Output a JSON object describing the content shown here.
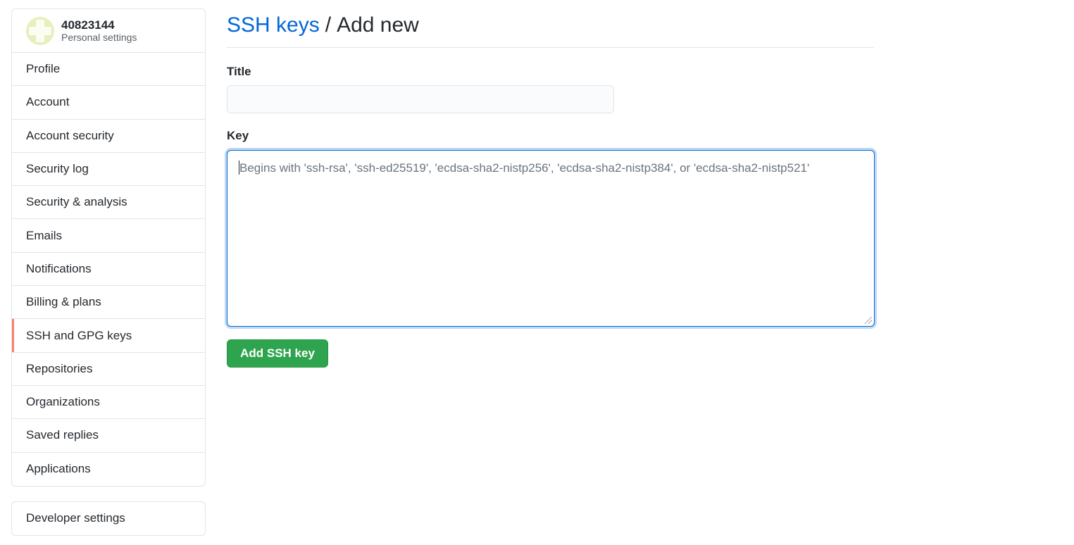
{
  "user": {
    "name": "40823144",
    "subtitle": "Personal settings"
  },
  "sidebar": {
    "items": [
      {
        "label": "Profile"
      },
      {
        "label": "Account"
      },
      {
        "label": "Account security"
      },
      {
        "label": "Security log"
      },
      {
        "label": "Security & analysis"
      },
      {
        "label": "Emails"
      },
      {
        "label": "Notifications"
      },
      {
        "label": "Billing & plans"
      },
      {
        "label": "SSH and GPG keys",
        "selected": true
      },
      {
        "label": "Repositories"
      },
      {
        "label": "Organizations"
      },
      {
        "label": "Saved replies"
      },
      {
        "label": "Applications"
      }
    ],
    "developer": {
      "label": "Developer settings"
    }
  },
  "header": {
    "link": "SSH keys",
    "separator": "/",
    "current": "Add new"
  },
  "form": {
    "title_label": "Title",
    "title_value": "",
    "key_label": "Key",
    "key_placeholder": "Begins with 'ssh-rsa', 'ssh-ed25519', 'ecdsa-sha2-nistp256', 'ecdsa-sha2-nistp384', or 'ecdsa-sha2-nistp521'",
    "submit_label": "Add SSH key"
  },
  "colors": {
    "accent": "#0366d6",
    "selected_marker": "#f9826c",
    "button": "#2ea44f"
  }
}
